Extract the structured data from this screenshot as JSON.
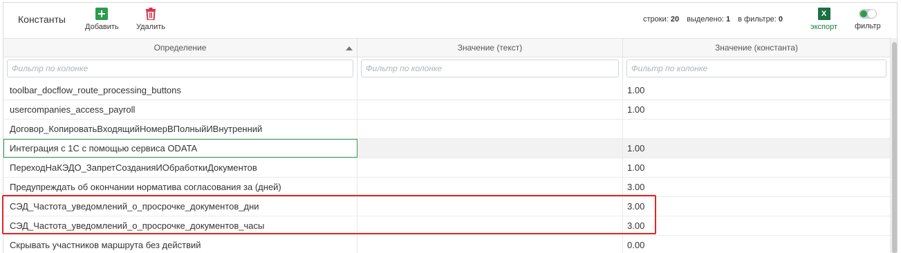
{
  "toolbar": {
    "title": "Константы",
    "add_label": "Добавить",
    "delete_label": "Удалить",
    "stats": {
      "rows_label": "строки:",
      "rows_value": "20",
      "selected_label": "выделено:",
      "selected_value": "1",
      "filter_label": "в фильтре:",
      "filter_value": "0"
    },
    "export_icon_text": "X",
    "export_label": "экспорт",
    "filter_toggle_label": "фильтр",
    "filter_toggle_on": true
  },
  "grid": {
    "columns": [
      {
        "label": "Определение",
        "sorted": "asc"
      },
      {
        "label": "Значение (текст)"
      },
      {
        "label": "Значение (константа)"
      }
    ],
    "filter_placeholder": "Фильтр по колонке",
    "rows": [
      {
        "definition": "toolbar_docflow_route_processing_buttons",
        "text": "",
        "constant": "1.00"
      },
      {
        "definition": "usercompanies_access_payroll",
        "text": "",
        "constant": "1.00"
      },
      {
        "definition": "Договор_КопироватьВходящийНомерВПолныйИВнутренний",
        "text": "",
        "constant": ""
      },
      {
        "definition": "Интеграция с 1С с помощью сервиса ODATA",
        "text": "",
        "constant": "1.00",
        "selected": true
      },
      {
        "definition": "ПереходНаКЭДО_ЗапретСозданияИОбработкиДокументов",
        "text": "",
        "constant": "1.00"
      },
      {
        "definition": "Предупреждать об окончании норматива согласования за (дней)",
        "text": "",
        "constant": "3.00"
      },
      {
        "definition": "СЭД_Частота_уведомлений_о_просрочке_документов_дни",
        "text": "",
        "constant": "3.00"
      },
      {
        "definition": "СЭД_Частота_уведомлений_о_просрочке_документов_часы",
        "text": "",
        "constant": "3.00"
      },
      {
        "definition": "Скрывать участников маршрута без действий",
        "text": "",
        "constant": "0.00"
      }
    ]
  },
  "colors": {
    "accent_green": "#2e9b4f",
    "excel_green": "#1d6f42",
    "delete_red": "#d9344a",
    "highlight_red": "#e02424"
  }
}
